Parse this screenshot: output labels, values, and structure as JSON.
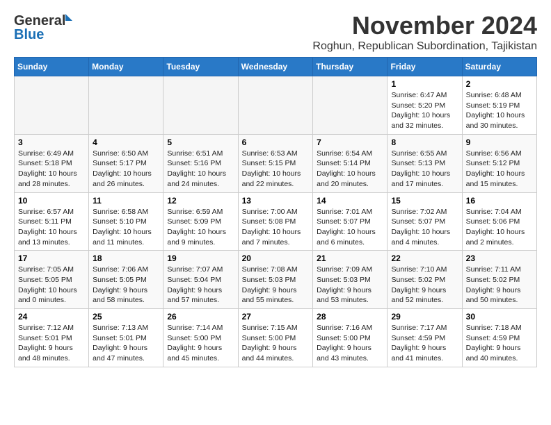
{
  "header": {
    "logo_general": "General",
    "logo_blue": "Blue",
    "month_title": "November 2024",
    "location": "Roghun, Republican Subordination, Tajikistan"
  },
  "weekdays": [
    "Sunday",
    "Monday",
    "Tuesday",
    "Wednesday",
    "Thursday",
    "Friday",
    "Saturday"
  ],
  "weeks": [
    [
      {
        "day": "",
        "info": ""
      },
      {
        "day": "",
        "info": ""
      },
      {
        "day": "",
        "info": ""
      },
      {
        "day": "",
        "info": ""
      },
      {
        "day": "",
        "info": ""
      },
      {
        "day": "1",
        "info": "Sunrise: 6:47 AM\nSunset: 5:20 PM\nDaylight: 10 hours\nand 32 minutes."
      },
      {
        "day": "2",
        "info": "Sunrise: 6:48 AM\nSunset: 5:19 PM\nDaylight: 10 hours\nand 30 minutes."
      }
    ],
    [
      {
        "day": "3",
        "info": "Sunrise: 6:49 AM\nSunset: 5:18 PM\nDaylight: 10 hours\nand 28 minutes."
      },
      {
        "day": "4",
        "info": "Sunrise: 6:50 AM\nSunset: 5:17 PM\nDaylight: 10 hours\nand 26 minutes."
      },
      {
        "day": "5",
        "info": "Sunrise: 6:51 AM\nSunset: 5:16 PM\nDaylight: 10 hours\nand 24 minutes."
      },
      {
        "day": "6",
        "info": "Sunrise: 6:53 AM\nSunset: 5:15 PM\nDaylight: 10 hours\nand 22 minutes."
      },
      {
        "day": "7",
        "info": "Sunrise: 6:54 AM\nSunset: 5:14 PM\nDaylight: 10 hours\nand 20 minutes."
      },
      {
        "day": "8",
        "info": "Sunrise: 6:55 AM\nSunset: 5:13 PM\nDaylight: 10 hours\nand 17 minutes."
      },
      {
        "day": "9",
        "info": "Sunrise: 6:56 AM\nSunset: 5:12 PM\nDaylight: 10 hours\nand 15 minutes."
      }
    ],
    [
      {
        "day": "10",
        "info": "Sunrise: 6:57 AM\nSunset: 5:11 PM\nDaylight: 10 hours\nand 13 minutes."
      },
      {
        "day": "11",
        "info": "Sunrise: 6:58 AM\nSunset: 5:10 PM\nDaylight: 10 hours\nand 11 minutes."
      },
      {
        "day": "12",
        "info": "Sunrise: 6:59 AM\nSunset: 5:09 PM\nDaylight: 10 hours\nand 9 minutes."
      },
      {
        "day": "13",
        "info": "Sunrise: 7:00 AM\nSunset: 5:08 PM\nDaylight: 10 hours\nand 7 minutes."
      },
      {
        "day": "14",
        "info": "Sunrise: 7:01 AM\nSunset: 5:07 PM\nDaylight: 10 hours\nand 6 minutes."
      },
      {
        "day": "15",
        "info": "Sunrise: 7:02 AM\nSunset: 5:07 PM\nDaylight: 10 hours\nand 4 minutes."
      },
      {
        "day": "16",
        "info": "Sunrise: 7:04 AM\nSunset: 5:06 PM\nDaylight: 10 hours\nand 2 minutes."
      }
    ],
    [
      {
        "day": "17",
        "info": "Sunrise: 7:05 AM\nSunset: 5:05 PM\nDaylight: 10 hours\nand 0 minutes."
      },
      {
        "day": "18",
        "info": "Sunrise: 7:06 AM\nSunset: 5:05 PM\nDaylight: 9 hours\nand 58 minutes."
      },
      {
        "day": "19",
        "info": "Sunrise: 7:07 AM\nSunset: 5:04 PM\nDaylight: 9 hours\nand 57 minutes."
      },
      {
        "day": "20",
        "info": "Sunrise: 7:08 AM\nSunset: 5:03 PM\nDaylight: 9 hours\nand 55 minutes."
      },
      {
        "day": "21",
        "info": "Sunrise: 7:09 AM\nSunset: 5:03 PM\nDaylight: 9 hours\nand 53 minutes."
      },
      {
        "day": "22",
        "info": "Sunrise: 7:10 AM\nSunset: 5:02 PM\nDaylight: 9 hours\nand 52 minutes."
      },
      {
        "day": "23",
        "info": "Sunrise: 7:11 AM\nSunset: 5:02 PM\nDaylight: 9 hours\nand 50 minutes."
      }
    ],
    [
      {
        "day": "24",
        "info": "Sunrise: 7:12 AM\nSunset: 5:01 PM\nDaylight: 9 hours\nand 48 minutes."
      },
      {
        "day": "25",
        "info": "Sunrise: 7:13 AM\nSunset: 5:01 PM\nDaylight: 9 hours\nand 47 minutes."
      },
      {
        "day": "26",
        "info": "Sunrise: 7:14 AM\nSunset: 5:00 PM\nDaylight: 9 hours\nand 45 minutes."
      },
      {
        "day": "27",
        "info": "Sunrise: 7:15 AM\nSunset: 5:00 PM\nDaylight: 9 hours\nand 44 minutes."
      },
      {
        "day": "28",
        "info": "Sunrise: 7:16 AM\nSunset: 5:00 PM\nDaylight: 9 hours\nand 43 minutes."
      },
      {
        "day": "29",
        "info": "Sunrise: 7:17 AM\nSunset: 4:59 PM\nDaylight: 9 hours\nand 41 minutes."
      },
      {
        "day": "30",
        "info": "Sunrise: 7:18 AM\nSunset: 4:59 PM\nDaylight: 9 hours\nand 40 minutes."
      }
    ]
  ]
}
